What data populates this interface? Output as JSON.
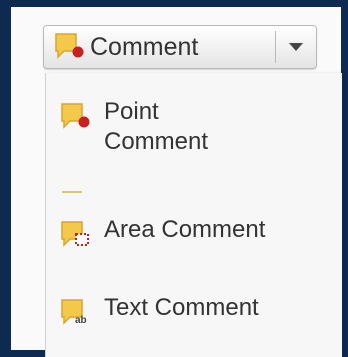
{
  "toolbar": {
    "comment_label": "Comment",
    "comment_icon": "comment-note-icon",
    "dropdown_icon": "chevron-down-icon"
  },
  "menu": {
    "items": [
      {
        "label_line1": "Point",
        "label_line2": "Comment",
        "icon": "point-comment-icon"
      },
      {
        "label": "Area Comment",
        "icon": "area-comment-icon"
      },
      {
        "label": "Text Comment",
        "icon": "text-comment-icon"
      }
    ]
  },
  "colors": {
    "note_yellow": "#f3c84b",
    "note_shadow": "#d9a52d",
    "marker_red": "#c8201e",
    "frame_navy": "#0d2a52"
  }
}
